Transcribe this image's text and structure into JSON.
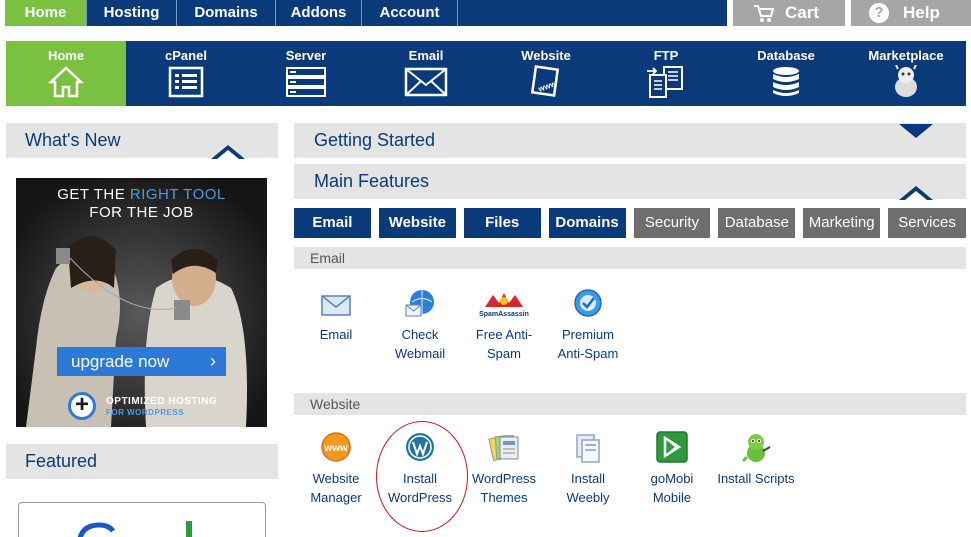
{
  "topnav": {
    "items": [
      "Home",
      "Hosting",
      "Domains",
      "Addons",
      "Account"
    ],
    "cart": "Cart",
    "help": "Help"
  },
  "iconbar": {
    "tabs": [
      "Home",
      "cPanel",
      "Server",
      "Email",
      "Website",
      "FTP",
      "Database",
      "Marketplace"
    ]
  },
  "left": {
    "whats_new": "What's New",
    "featured": "Featured",
    "ad": {
      "line1_a": "GET THE ",
      "line1_b": "RIGHT TOOL",
      "line2": "FOR THE JOB",
      "button": "upgrade now",
      "opt1": "OPTIMIZED HOSTING",
      "opt2": "FOR WORDPRESS"
    }
  },
  "right": {
    "getting_started": "Getting Started",
    "main_features": "Main Features",
    "feature_tabs": [
      "Email",
      "Website",
      "Files",
      "Domains",
      "Security",
      "Database",
      "Marketing",
      "Services"
    ],
    "email_section": {
      "title": "Email",
      "items": [
        {
          "line1": "Email",
          "line2": ""
        },
        {
          "line1": "Check",
          "line2": "Webmail"
        },
        {
          "line1": "Free Anti-",
          "line2": "Spam"
        },
        {
          "line1": "Premium",
          "line2": "Anti-Spam"
        }
      ],
      "spam_logo": "SpamAssassin"
    },
    "website_section": {
      "title": "Website",
      "items": [
        {
          "line1": "Website",
          "line2": "Manager"
        },
        {
          "line1": "Install",
          "line2": "WordPress"
        },
        {
          "line1": "WordPress",
          "line2": "Themes"
        },
        {
          "line1": "Install",
          "line2": "Weebly"
        },
        {
          "line1": "goMobi",
          "line2": "Mobile"
        },
        {
          "line1": "Install Scripts",
          "line2": ""
        }
      ],
      "www_badge": "www"
    }
  },
  "colors": {
    "navy": "#0a3a7a",
    "green": "#7ac142",
    "gray_tab": "#6e6e6e",
    "panel": "#e4e4e4",
    "highlight_oval": "#c0191e"
  }
}
